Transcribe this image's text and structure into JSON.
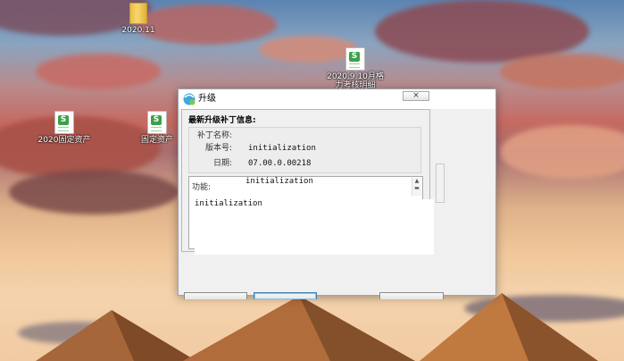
{
  "desktop": {
    "icons": [
      {
        "label": "2020.11",
        "type": "folder"
      },
      {
        "label": "2020.9.10月格力考核明细",
        "type": "spreadsheet"
      },
      {
        "label": "2020固定资产",
        "type": "spreadsheet"
      },
      {
        "label": "固定资产",
        "type": "spreadsheet"
      }
    ]
  },
  "dialog": {
    "title": "升级",
    "close_label": "⨯",
    "info_header": "最新升级补丁信息:",
    "fields": {
      "patch_name_label": "补丁名称:",
      "patch_name_value": "",
      "version_label": "版本号:",
      "version_value": "initialization",
      "date_label": "日期:",
      "date_value": "07.00.0.00218"
    },
    "function": {
      "label": "功能:",
      "title_value": "initialization",
      "body_text": "initialization"
    }
  },
  "colors": {
    "title_bg": "#ffffff",
    "dialog_bg": "#f0f0f0",
    "accent_border": "#3c7fb1"
  }
}
